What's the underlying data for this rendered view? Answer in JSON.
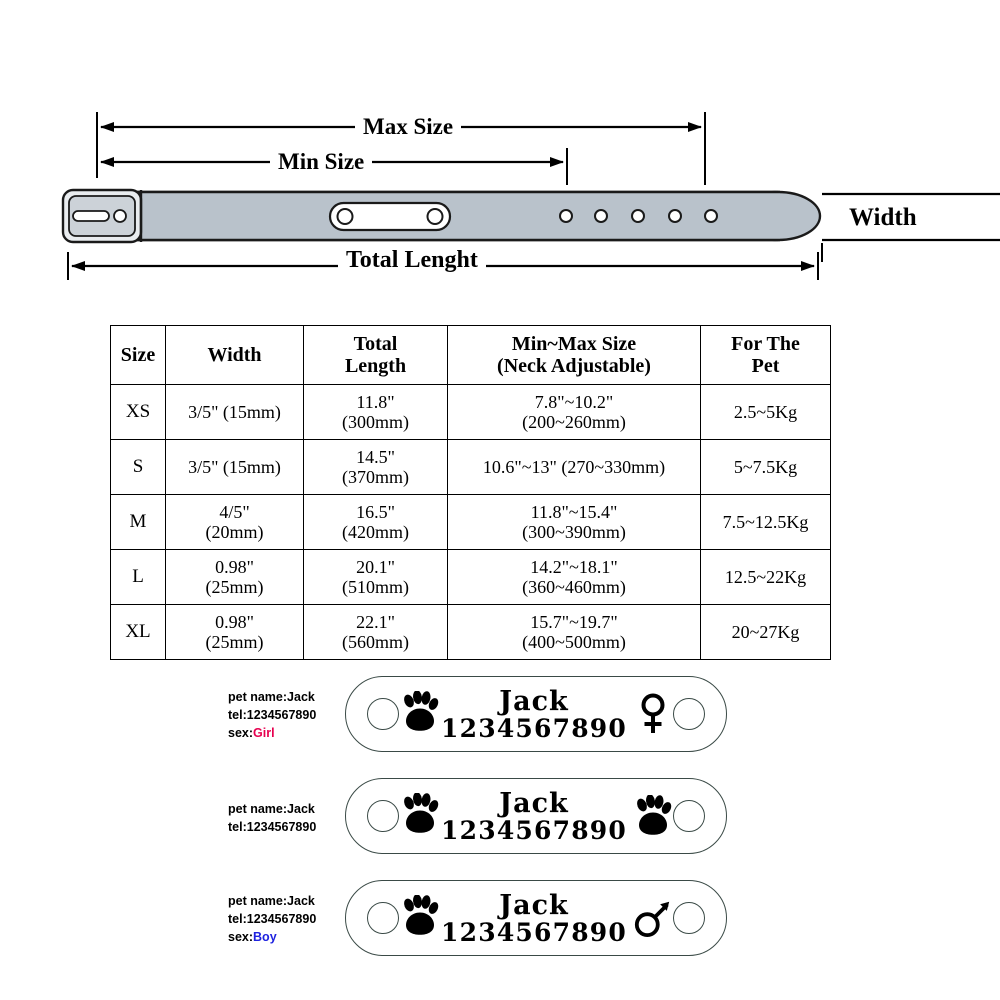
{
  "diagram": {
    "max_size_label": "Max Size",
    "min_size_label": "Min  Size",
    "total_length_label": "Total Lenght",
    "width_label": "Width",
    "strap_color": "#b9c2cb",
    "outline_color": "#1a1a1a",
    "nameplate_color": "#ffffff",
    "hole_count": 5
  },
  "table": {
    "headers": [
      "Size",
      "Width",
      "Total\nLength",
      "Min~Max Size\n(Neck Adjustable)",
      "For The\nPet"
    ],
    "header_lines": [
      [
        "Size"
      ],
      [
        "Width"
      ],
      [
        "Total",
        "Length"
      ],
      [
        "Min~Max Size",
        "(Neck Adjustable)"
      ],
      [
        "For The",
        "Pet"
      ]
    ],
    "rows": [
      {
        "size": "XS",
        "width": [
          "3/5\" (15mm)"
        ],
        "total_length": [
          "11.8\"",
          "(300mm)"
        ],
        "min_max": [
          "7.8\"~10.2\"",
          "(200~260mm)"
        ],
        "for_the_pet": [
          "2.5~5Kg"
        ]
      },
      {
        "size": "S",
        "width": [
          "3/5\" (15mm)"
        ],
        "total_length": [
          "14.5\"",
          "(370mm)"
        ],
        "min_max": [
          "10.6\"~13\" (270~330mm)"
        ],
        "for_the_pet": [
          "5~7.5Kg"
        ]
      },
      {
        "size": "M",
        "width": [
          "4/5\"",
          "(20mm)"
        ],
        "total_length": [
          "16.5\"",
          "(420mm)"
        ],
        "min_max": [
          "11.8\"~15.4\"",
          "(300~390mm)"
        ],
        "for_the_pet": [
          "7.5~12.5Kg"
        ]
      },
      {
        "size": "L",
        "width": [
          "0.98\"",
          "(25mm)"
        ],
        "total_length": [
          "20.1\"",
          "(510mm)"
        ],
        "min_max": [
          "14.2\"~18.1\"",
          "(360~460mm)"
        ],
        "for_the_pet": [
          "12.5~22Kg"
        ]
      },
      {
        "size": "XL",
        "width": [
          "0.98\"",
          "(25mm)"
        ],
        "total_length": [
          "22.1\"",
          "(560mm)"
        ],
        "min_max": [
          "15.7\"~19.7\"",
          "(400~500mm)"
        ],
        "for_the_pet": [
          "20~27Kg"
        ]
      }
    ]
  },
  "tags": {
    "colors": {
      "girl": "#e6004f",
      "boy": "#1e22e0"
    },
    "items": [
      {
        "caption": {
          "pet_name": "pet name:Jack",
          "tel": "tel:1234567890",
          "sex_label": "sex:",
          "sex_value": "Girl"
        },
        "name": "Jack",
        "phone": "1234567890",
        "left_mark": "paw-icon",
        "right_mark": "female-symbol-icon"
      },
      {
        "caption": {
          "pet_name": "pet name:Jack",
          "tel": "tel:1234567890",
          "sex_label": "",
          "sex_value": ""
        },
        "name": "Jack",
        "phone": "1234567890",
        "left_mark": "paw-icon",
        "right_mark": "paw-icon"
      },
      {
        "caption": {
          "pet_name": "pet name:Jack",
          "tel": "tel:1234567890",
          "sex_label": "sex:",
          "sex_value": "Boy"
        },
        "name": "Jack",
        "phone": "1234567890",
        "left_mark": "paw-icon",
        "right_mark": "male-symbol-icon"
      }
    ]
  }
}
